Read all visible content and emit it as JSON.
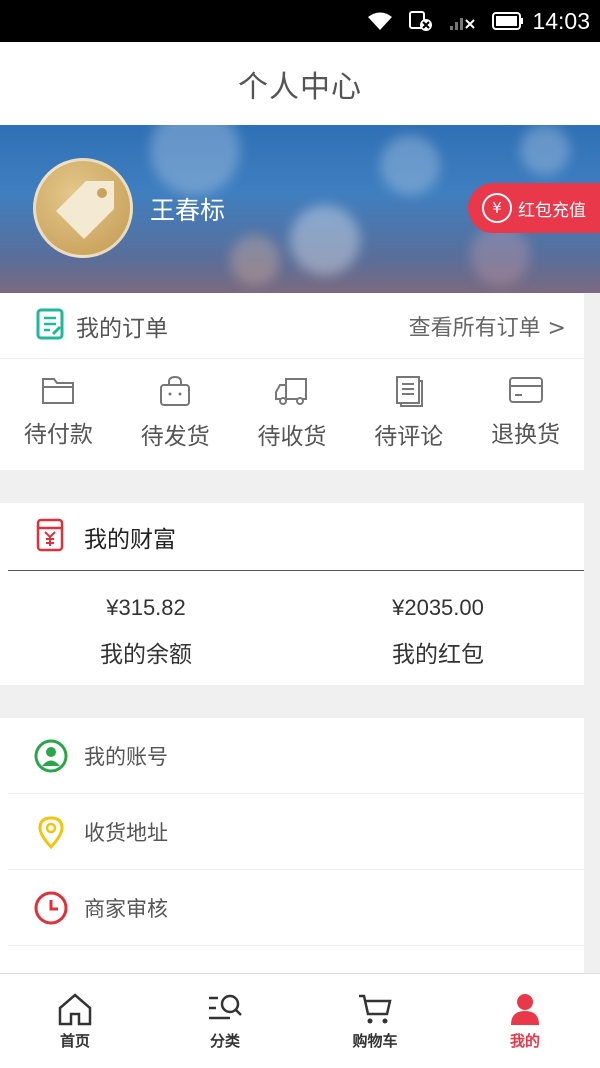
{
  "status_bar": {
    "time": "14:03"
  },
  "header": {
    "title": "个人中心"
  },
  "profile": {
    "username": "王春标",
    "redpack_button": "红包充值",
    "yen_symbol": "¥"
  },
  "orders": {
    "title": "我的订单",
    "view_all": "查看所有订单 >",
    "items": [
      {
        "label": "待付款",
        "icon": "folder-icon"
      },
      {
        "label": "待发货",
        "icon": "bag-icon"
      },
      {
        "label": "待收货",
        "icon": "truck-icon"
      },
      {
        "label": "待评论",
        "icon": "document-icon"
      },
      {
        "label": "退换货",
        "icon": "card-icon"
      }
    ]
  },
  "wealth": {
    "title": "我的财富",
    "balance_amount": "¥315.82",
    "balance_label": "我的余额",
    "redpack_amount": "¥2035.00",
    "redpack_label": "我的红包"
  },
  "menu": {
    "items": [
      {
        "label": "我的账号",
        "icon": "account-icon",
        "color": "#2aa54a"
      },
      {
        "label": "收货地址",
        "icon": "location-pin-icon",
        "color": "#f1c40f"
      },
      {
        "label": "商家审核",
        "icon": "clock-icon",
        "color": "#e0303a"
      }
    ]
  },
  "bottom_nav": {
    "items": [
      {
        "label": "首页",
        "icon": "home-icon"
      },
      {
        "label": "分类",
        "icon": "category-search-icon"
      },
      {
        "label": "购物车",
        "icon": "cart-icon"
      },
      {
        "label": "我的",
        "icon": "user-icon"
      }
    ],
    "active_index": 3
  },
  "colors": {
    "accent": "#e8384a",
    "order_icon": "#1fb89a"
  }
}
